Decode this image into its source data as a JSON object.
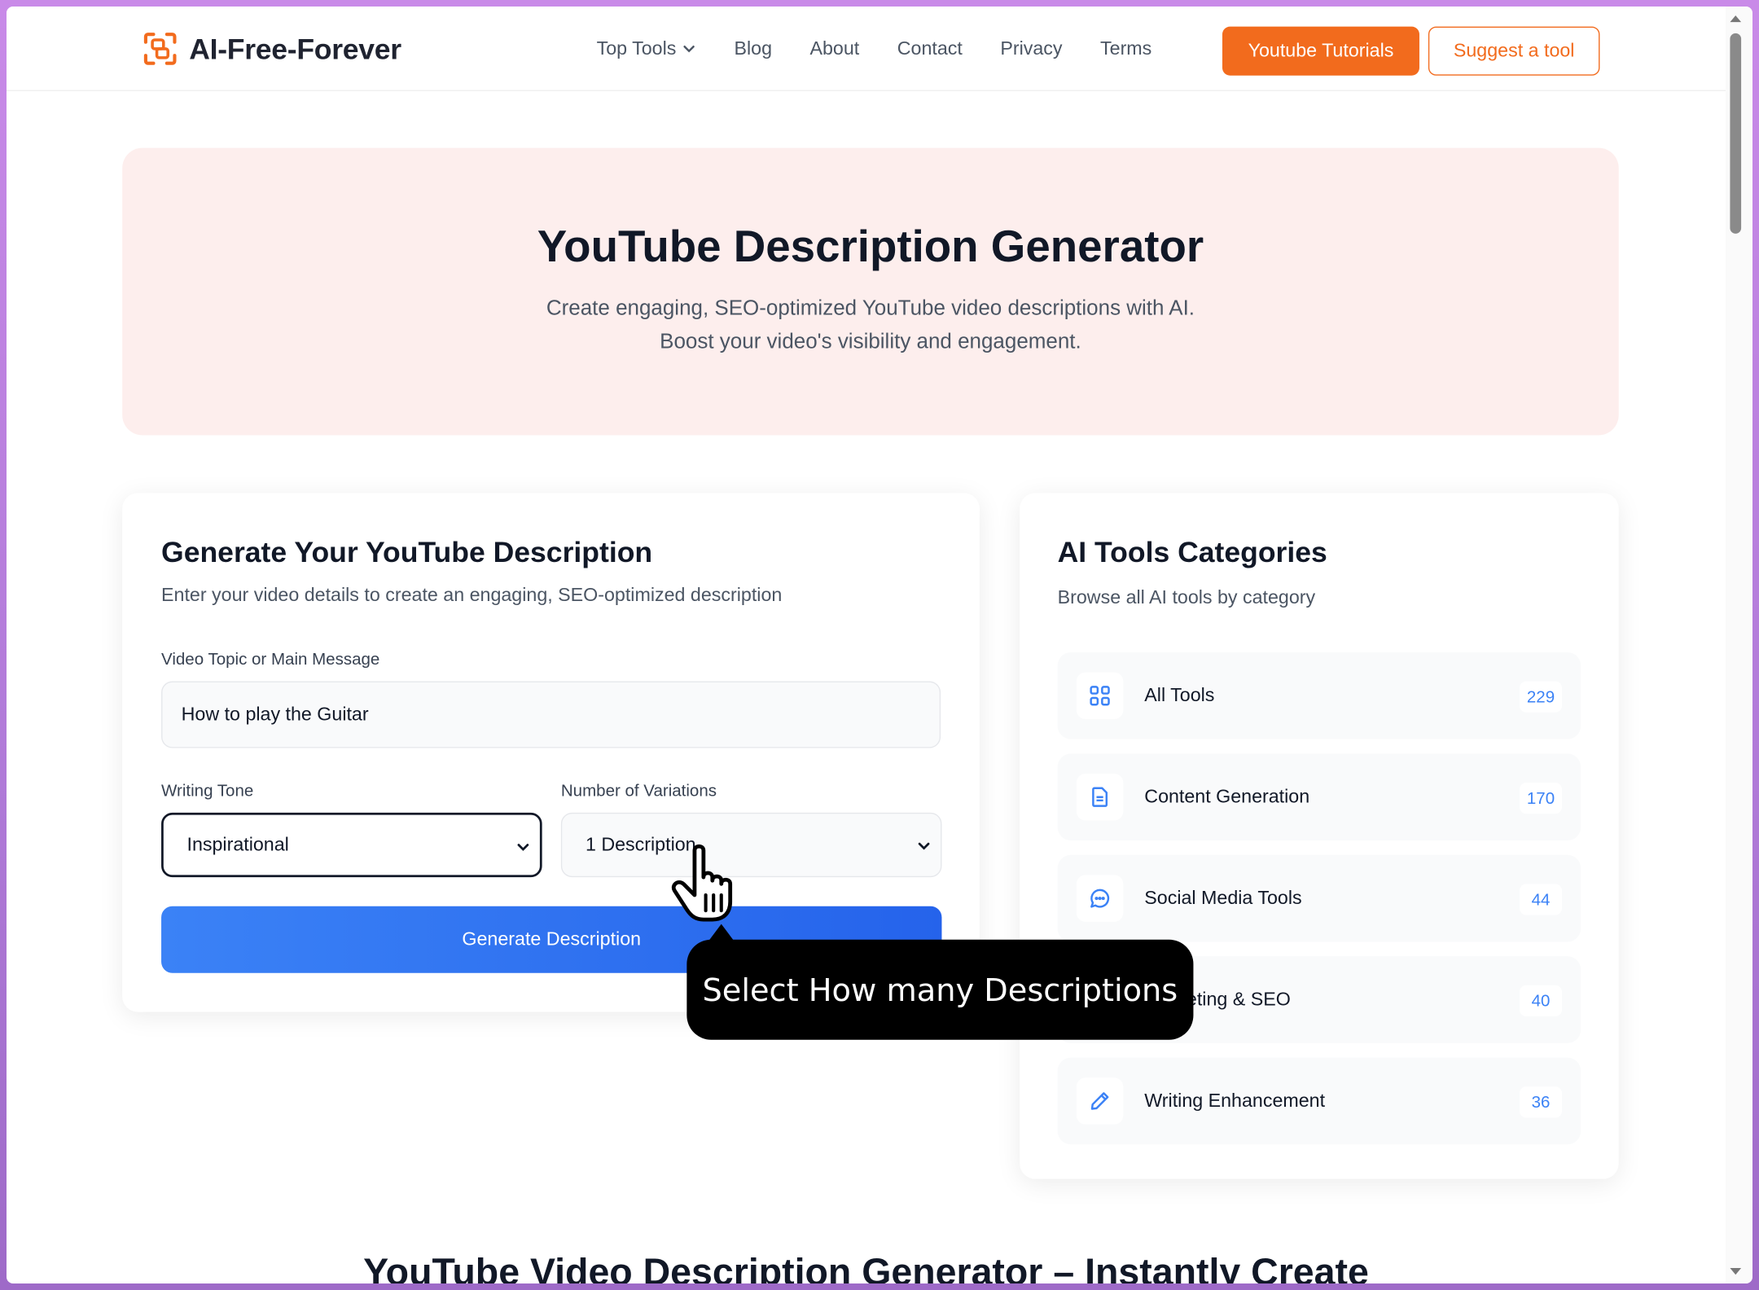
{
  "header": {
    "logo_text": "AI-Free-Forever",
    "nav": [
      {
        "label": "Top Tools"
      },
      {
        "label": "Blog"
      },
      {
        "label": "About"
      },
      {
        "label": "Contact"
      },
      {
        "label": "Privacy"
      },
      {
        "label": "Terms"
      }
    ],
    "youtube_button": "Youtube Tutorials",
    "suggest_button": "Suggest a tool"
  },
  "hero": {
    "title": "YouTube Description Generator",
    "subtitle_line1": "Create engaging, SEO-optimized YouTube video descriptions with AI.",
    "subtitle_line2": "Boost your video's visibility and engagement."
  },
  "form": {
    "title": "Generate Your YouTube Description",
    "subtitle": "Enter your video details to create an engaging, SEO-optimized description",
    "topic_label": "Video Topic or Main Message",
    "topic_value": "How to play the Guitar",
    "tone_label": "Writing Tone",
    "tone_value": "Inspirational",
    "variations_label": "Number of Variations",
    "variations_value": "1 Description",
    "generate_button": "Generate Description"
  },
  "categories": {
    "title": "AI Tools Categories",
    "subtitle": "Browse all AI tools by category",
    "items": [
      {
        "label": "All Tools",
        "count": "229",
        "icon": "grid-icon"
      },
      {
        "label": "Content Generation",
        "count": "170",
        "icon": "document-icon"
      },
      {
        "label": "Social Media Tools",
        "count": "44",
        "icon": "chat-icon"
      },
      {
        "label": "Marketing & SEO",
        "count": "40",
        "icon": "chart-icon"
      },
      {
        "label": "Writing Enhancement",
        "count": "36",
        "icon": "pencil-icon"
      }
    ]
  },
  "bottom_heading": "YouTube Video Description Generator – Instantly Create",
  "tooltip": "Select How many Descriptions",
  "colors": {
    "accent_orange": "#f26b1d",
    "accent_blue": "#3b82f6",
    "hero_bg": "#fdeeed"
  }
}
